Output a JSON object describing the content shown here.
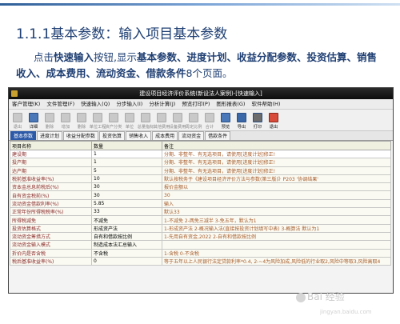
{
  "slide": {
    "title": "1.1.1基本参数：输入项目基本参数",
    "intro": {
      "p1": "点击",
      "b1": "快速输入",
      "p2": "按钮,显示",
      "b2": "基本参数、进度计划、收益分配参数、投资估算、销售收入、成本费用、流动资金、借款条件",
      "p3": "8个页面。"
    }
  },
  "window": {
    "title": "建设项目经济评价系统(新设法人案例)-[快速输入]",
    "menu": [
      "客户管理(K)",
      "文件管理(F)",
      "快速输入(Q)",
      "分步输入(I)",
      "分析计算(J)",
      "预览打印(P)",
      "图形报表(G)",
      "软件帮助(H)"
    ],
    "toolbar": [
      {
        "label": "退出",
        "icon": "back-icon",
        "enabled": false
      },
      {
        "label": "详细",
        "icon": "detail-icon",
        "enabled": true
      },
      {
        "label": "删除",
        "icon": "remove-icon",
        "enabled": false
      },
      {
        "label": "增加",
        "icon": "add-icon",
        "enabled": false
      },
      {
        "label": "删除",
        "icon": "delete-icon",
        "enabled": false
      },
      {
        "label": "单位工程",
        "icon": "unit-icon",
        "enabled": false
      },
      {
        "label": "资产分类",
        "icon": "asset-icon",
        "enabled": false
      },
      {
        "label": "单位",
        "icon": "unit2-icon",
        "enabled": false
      },
      {
        "label": "总量指标",
        "icon": "total-icon",
        "enabled": false
      },
      {
        "label": "其他费用",
        "icon": "other-icon",
        "enabled": false
      },
      {
        "label": "设备费用",
        "icon": "equip-icon",
        "enabled": false
      },
      {
        "label": "周定比例",
        "icon": "ratio-icon",
        "enabled": false
      },
      {
        "label": "合计",
        "icon": "sum-icon",
        "enabled": false
      },
      {
        "label": "预览",
        "icon": "preview-icon",
        "enabled": true
      },
      {
        "label": "导出",
        "icon": "export-icon",
        "enabled": true
      },
      {
        "label": "打印",
        "icon": "print-icon",
        "enabled": true
      },
      {
        "label": "退出",
        "icon": "exit-icon",
        "enabled": true
      }
    ],
    "tabs": [
      "基本参数",
      "进度计划",
      "收益分配参数",
      "投资估算",
      "销售收入",
      "成本费用",
      "流动资金",
      "借款条件"
    ],
    "grid": {
      "headers": [
        "项目名称",
        "数量",
        "备注"
      ],
      "rows": [
        [
          "建设期",
          "1",
          "分期、非整年、有无选项目，请使用[进度计划]修正!"
        ],
        [
          "投产期",
          "1",
          "分期、非整年、有无选项目，请使用[进度计划]修正!"
        ],
        [
          "达产期",
          "5",
          "分期、非整年、有无选项目，请使用[进度计划]修正!"
        ],
        [
          "税前基准收益率(%)",
          "10",
          "默认按税务于《建设项目经济评价方法与参数(第三版)》P203 '协调结果'"
        ],
        [
          "资本金总息前税后(%)",
          "30",
          "报价金额以"
        ],
        [
          "自有资金税前(%)",
          "30",
          "30"
        ],
        [
          "流动资金借款利率(%)",
          "5.85",
          "输入"
        ],
        [
          "正常年份所得税税率(%)",
          "33",
          "默认33"
        ],
        [
          "所得税减免",
          "不减免",
          "1-不减免 2-两免三减半 3-免五年，默认为1"
        ],
        [
          "投资估算格式",
          "形成资产法",
          "1-形成资产法 2-概况输入法(直接按投资计划填写中表) 3-概算法 默认为1"
        ],
        [
          "流动资金筹措方式",
          "自有和借款按比例",
          "1-先用自有资金,2022 2-自有和借款按比例"
        ],
        [
          "流动资金输入模式",
          "制造成本法汇总输入",
          ""
        ],
        [
          "折价内是否含税",
          "不含税",
          "1-含税 0-不含税"
        ],
        [
          "税后基准收益率(%)",
          "0",
          "等于五年以上人民银行法定贷款利率*0.4, 2-~4为风险加成,风险低的行业取2,风险中等取3,风险高取4"
        ]
      ]
    }
  },
  "watermark": {
    "text": "Bai 经验",
    "url": "jingyan.baidu.com"
  }
}
